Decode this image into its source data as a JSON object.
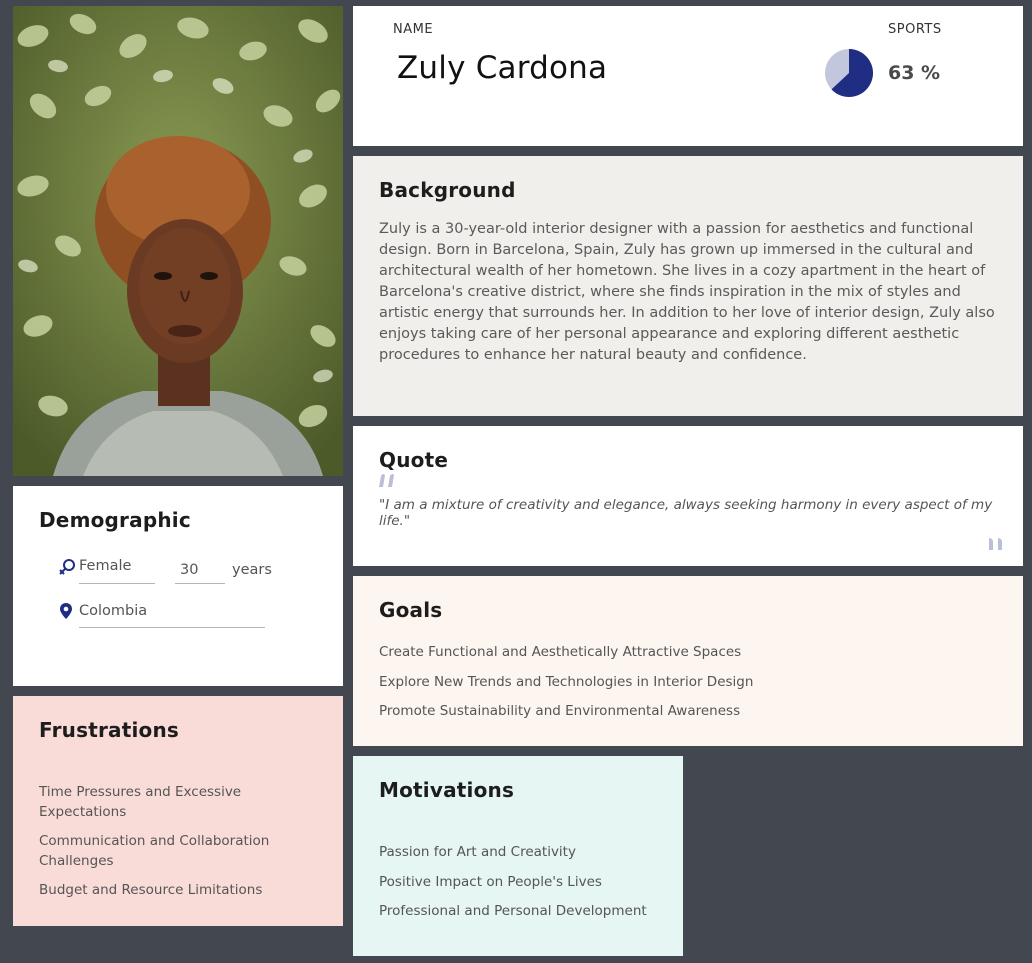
{
  "header": {
    "name_label": "NAME",
    "name": "Zuly Cardona",
    "sports_label": "SPORTS",
    "sports_value": "63 %",
    "sports_fraction": 0.63
  },
  "background": {
    "title": "Background",
    "text": "Zuly is a 30-year-old interior designer with a passion for aesthetics and functional design. Born in Barcelona, Spain, Zuly has grown up immersed in the cultural and architectural wealth of her hometown. She lives in a cozy apartment in the heart of Barcelona's creative district, where she finds inspiration in the mix of styles and artistic energy that surrounds her. In addition to her love of interior design, Zuly also enjoys taking care of her personal appearance and exploring different aesthetic procedures to enhance her natural beauty and confidence."
  },
  "quote": {
    "title": "Quote",
    "text": "\"I am a mixture of creativity and elegance, always seeking harmony in every aspect of my life.\""
  },
  "goals": {
    "title": "Goals",
    "items": [
      "Create Functional and Aesthetically Attractive Spaces",
      "Explore New Trends and Technologies in Interior Design",
      "Promote Sustainability and Environmental Awareness"
    ]
  },
  "motivations": {
    "title": "Motivations",
    "items": [
      "Passion for Art and Creativity",
      "Positive Impact on People's Lives",
      "Professional and Personal Development"
    ]
  },
  "demographic": {
    "title": "Demographic",
    "gender": "Female",
    "age": "30",
    "age_unit": "years",
    "country": "Colombia"
  },
  "frustrations": {
    "title": "Frustrations",
    "items": [
      "Time Pressures and Excessive Expectations",
      "Communication and Collaboration Challenges",
      "Budget and Resource Limitations"
    ]
  },
  "colors": {
    "page_bg": "#434750",
    "accent_navy": "#1f2e82",
    "accent_light": "#c3c7de",
    "quote_mark": "#b9bfd8"
  }
}
